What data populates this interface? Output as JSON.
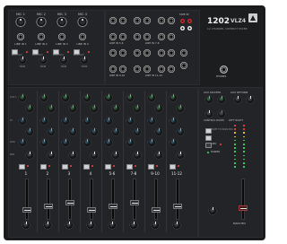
{
  "brand": {
    "model": "1202",
    "suffix": "VLZ4",
    "subtitle": "12-CHANNEL COMPACT MIXER"
  },
  "inputs": {
    "mic_labels": [
      "MIC 1",
      "MIC 2",
      "MIC 3",
      "MIC 4"
    ],
    "line_labels": [
      "LINE IN 1",
      "LINE IN 2",
      "LINE IN 3",
      "LINE IN 4"
    ],
    "trim_label": "TRIM",
    "low_cut_label": "LOW CUT",
    "stereo_labels": [
      "LINE IN 5-6",
      "LINE IN 7-8",
      "LINE IN 9-10",
      "LINE IN 11-12"
    ],
    "tape_label": "TAPE IN",
    "phones_label": "PHONES"
  },
  "channel_strips": {
    "numbers": [
      "1",
      "2",
      "3",
      "4",
      "5-6",
      "7-8",
      "9-10",
      "11-12"
    ],
    "row_labels": [
      "AUX 1",
      "AUX 2",
      "HI",
      "MID",
      "LOW",
      "PAN",
      "MUTE"
    ],
    "hi_freq": "12kHz",
    "low_freq": "80Hz",
    "ol_label": "OL",
    "level_label": "LEVEL"
  },
  "master": {
    "aux_master_label": "AUX MASTER",
    "aux_return_label": "AUX RETURN",
    "control_room_label": "CONTROL ROOM",
    "tape_to_main_label": "TAPE TO MAIN MIX",
    "meter_label": "LEFT RIGHT",
    "main_mix_label": "MAIN MIX",
    "power_label": "POWER",
    "phantom_label": "48V"
  },
  "colors": {
    "panel": "#1c1d1f",
    "green_knob": "#3bd06a",
    "blue_knob": "#3fb9e8",
    "red_accent": "#e0413a"
  }
}
